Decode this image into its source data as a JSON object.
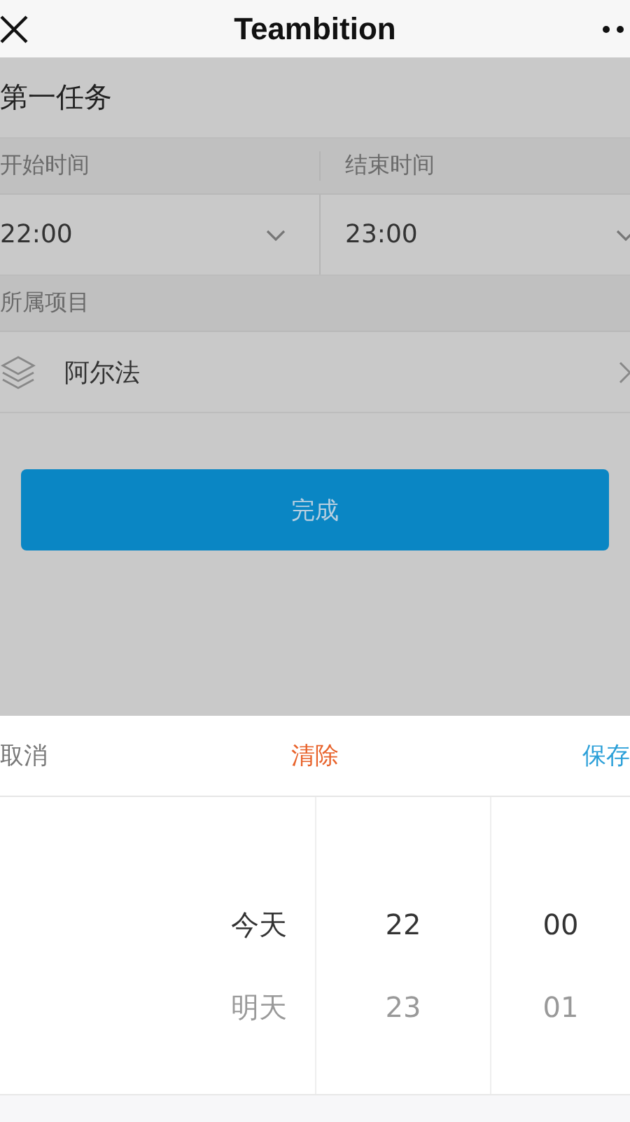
{
  "nav": {
    "title": "Teambition"
  },
  "task": {
    "title": "第一任务"
  },
  "time": {
    "start_label": "开始时间",
    "end_label": "结束时间",
    "start": "22:00",
    "end": "23:00"
  },
  "project": {
    "label": "所属项目",
    "name": "阿尔法"
  },
  "done_button": "完成",
  "sheet": {
    "cancel": "取消",
    "clear": "清除",
    "save": "保存",
    "columns": [
      {
        "kind": "day",
        "items": [
          {
            "text": "今天",
            "selected": true
          },
          {
            "text": "明天",
            "selected": false
          }
        ]
      },
      {
        "kind": "hour",
        "items": [
          {
            "text": "22",
            "selected": true
          },
          {
            "text": "23",
            "selected": false
          }
        ]
      },
      {
        "kind": "minute",
        "items": [
          {
            "text": "00",
            "selected": true
          },
          {
            "text": "01",
            "selected": false
          }
        ]
      }
    ]
  }
}
